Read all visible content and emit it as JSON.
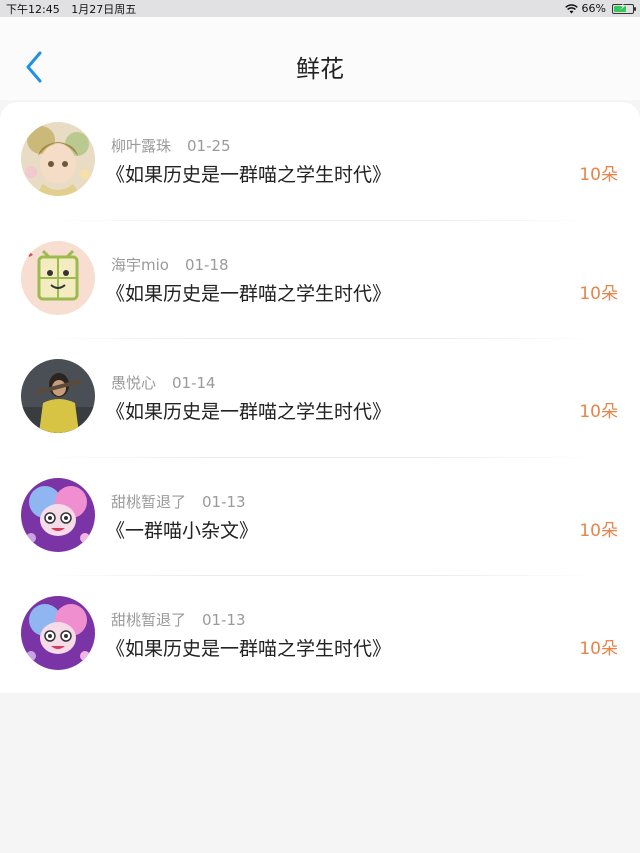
{
  "status_bar": {
    "time": "下午12:45",
    "date": "1月27日周五",
    "battery": "66%",
    "battery_level": 0.66
  },
  "nav": {
    "title": "鲜花"
  },
  "records": [
    {
      "user": "柳叶露珠",
      "date": "01-25",
      "title": "《如果历史是一群喵之学生时代》",
      "amount": "10朵"
    },
    {
      "user": "海宇mio",
      "date": "01-18",
      "title": "《如果历史是一群喵之学生时代》",
      "amount": "10朵"
    },
    {
      "user": "愚悦心",
      "date": "01-14",
      "title": "《如果历史是一群喵之学生时代》",
      "amount": "10朵"
    },
    {
      "user": "甜桃暂退了",
      "date": "01-13",
      "title": "《一群喵小杂文》",
      "amount": "10朵"
    },
    {
      "user": "甜桃暂退了",
      "date": "01-13",
      "title": "《如果历史是一群喵之学生时代》",
      "amount": "10朵"
    }
  ],
  "colors": {
    "accent_blue": "#1e90e8",
    "amount_orange": "#e8834a"
  }
}
